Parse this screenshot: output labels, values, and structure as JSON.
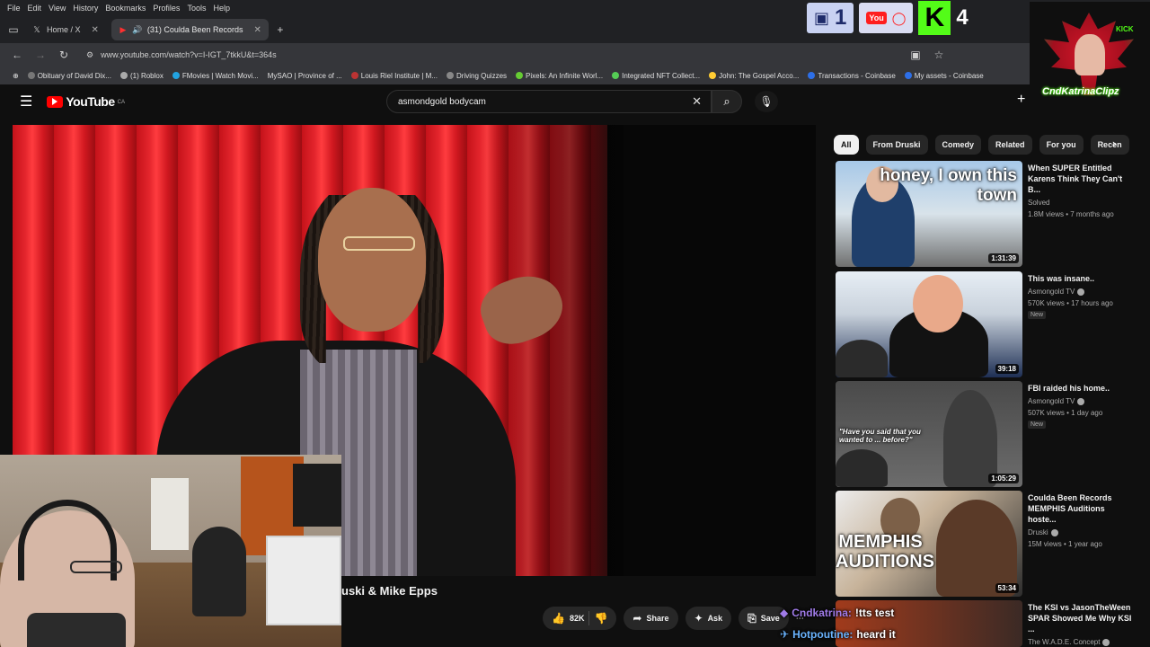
{
  "browser": {
    "menu": [
      "File",
      "Edit",
      "View",
      "History",
      "Bookmarks",
      "Profiles",
      "Tools",
      "Help"
    ],
    "tabs": [
      {
        "label": "Home / X"
      },
      {
        "label": "(31) Coulda Been Records"
      }
    ],
    "url": "www.youtube.com/watch?v=I-IGT_7tkkU&t=364s",
    "bookmarks": [
      "Obituary of David Dix...",
      "(1) Roblox",
      "FMovies | Watch Movi...",
      "MySAO | Province of ...",
      "Louis Riel Institute | M...",
      "Driving Quizzes",
      "Pixels: An Infinite Worl...",
      "Integrated NFT Collect...",
      "John: The Gospel Acco...",
      "Transactions - Coinbase",
      "My assets - Coinbase"
    ]
  },
  "youtube": {
    "logo": "YouTube",
    "region": "CA",
    "search_query": "asmondgold bodycam",
    "video_title": "uski & Mike Epps",
    "actions": {
      "likes": "82K",
      "share": "Share",
      "ask": "Ask",
      "save": "Save"
    },
    "chips": [
      "All",
      "From Druski",
      "Comedy",
      "Related",
      "For you",
      "Recen"
    ],
    "recommendations": [
      {
        "title": "When SUPER Entitled Karens Think They Can't B...",
        "channel": "Solved",
        "verified": false,
        "views": "1.8M views • 7 months ago",
        "new": false,
        "duration": "1:31:39",
        "thumb_text": "honey, I own this town"
      },
      {
        "title": "This was insane..",
        "channel": "Asmongold TV",
        "verified": true,
        "views": "570K views • 17 hours ago",
        "new": true,
        "duration": "39:18",
        "thumb_text": ""
      },
      {
        "title": "FBI raided his home..",
        "channel": "Asmongold TV",
        "verified": true,
        "views": "507K views • 1 day ago",
        "new": true,
        "duration": "1:05:29",
        "thumb_text": "\"Have you said that you wanted to ... before?\""
      },
      {
        "title": "Coulda Been Records MEMPHIS Auditions hoste...",
        "channel": "Druski",
        "verified": true,
        "views": "15M views • 1 year ago",
        "new": false,
        "duration": "53:34",
        "thumb_text": "MEMPHIS AUDITIONS"
      },
      {
        "title": "The KSI vs JasonTheWeen SPAR Showed Me Why KSI ...",
        "channel": "The W.A.D.E. Concept",
        "verified": true,
        "views": "",
        "new": false,
        "duration": "",
        "thumb_text": ""
      }
    ]
  },
  "stream_overlay": {
    "twitch_count": "1",
    "kick_count": "4",
    "streamer_logo_text": "CndKatrinaClipz",
    "logo_badge": "KICK",
    "chat": [
      {
        "user": "Cndkatrina:",
        "message": "!tts test"
      },
      {
        "user": "Hotpoutine:",
        "message": "heard it"
      }
    ]
  }
}
